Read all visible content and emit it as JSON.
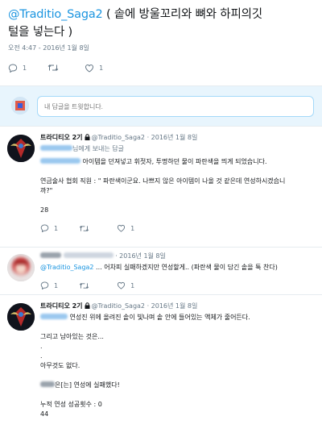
{
  "main_tweet": {
    "handle": "@Traditio_Saga2",
    "text_line1": " ( 솥에 방울꼬리와 뼈와 하피의깃",
    "text_line2": "털을 넣는다 )",
    "timestamp": "오전 4:47 - 2016년 1월 8일",
    "reply_count": "1",
    "retweet_count": "",
    "like_count": "1"
  },
  "reply_box": {
    "placeholder": "내 답글을 트윗합니다."
  },
  "tweets": [
    {
      "name": "트라디티오 2기",
      "handle": "@Traditio_Saga2",
      "date": "· 2016년 1월 8일",
      "reply_to_suffix": "님에게 보내는 답글",
      "body_line1_suffix": " 아이템을 던져넣고 휘젓자, 투명하던 물이 파란색을 띄게 되었습니다.",
      "body_line2": "연금술사 협회 직원 : \" 파란색이군요. 나쁘지 않은 아이템이 나올 것 같은데 연성하시겠습니",
      "body_line3": "까?\"",
      "body_line4": "28",
      "reply_count": "1",
      "like_count": "1"
    },
    {
      "date": "· 2016년 1월 8일",
      "mention": "@Traditio_Saga2",
      "body": " ... 어차피 실패하겠지만 연성할게.. (파란색 물이 담긴 솥을 툭 찬다)",
      "reply_count": "1",
      "like_count": "1"
    },
    {
      "name": "트라디티오 2기",
      "handle": "@Traditio_Saga2",
      "date": "· 2016년 1월 8일",
      "body_line1_suffix": " 연성진 위에 올려진 솥이 빛나며 솥 안에 들어있는 액체가 줄어든다.",
      "body_line2": "그리고 남아있는 것은...",
      "body_line3": ".",
      "body_line4": ".",
      "body_line5": "아무것도 없다.",
      "body_line6_suffix": "은[는] 연성에 실패했다!",
      "body_line7": "누적 연성 성공횟수 : 0",
      "body_line8": "44"
    }
  ],
  "colors": {
    "link": "#1b95e0",
    "secondary_text": "#657786",
    "reply_box_bg": "#e8f5fd",
    "divider": "#e6ecf0"
  },
  "icons": [
    "reply-icon",
    "retweet-icon",
    "like-icon",
    "lock-icon",
    "avatar"
  ]
}
